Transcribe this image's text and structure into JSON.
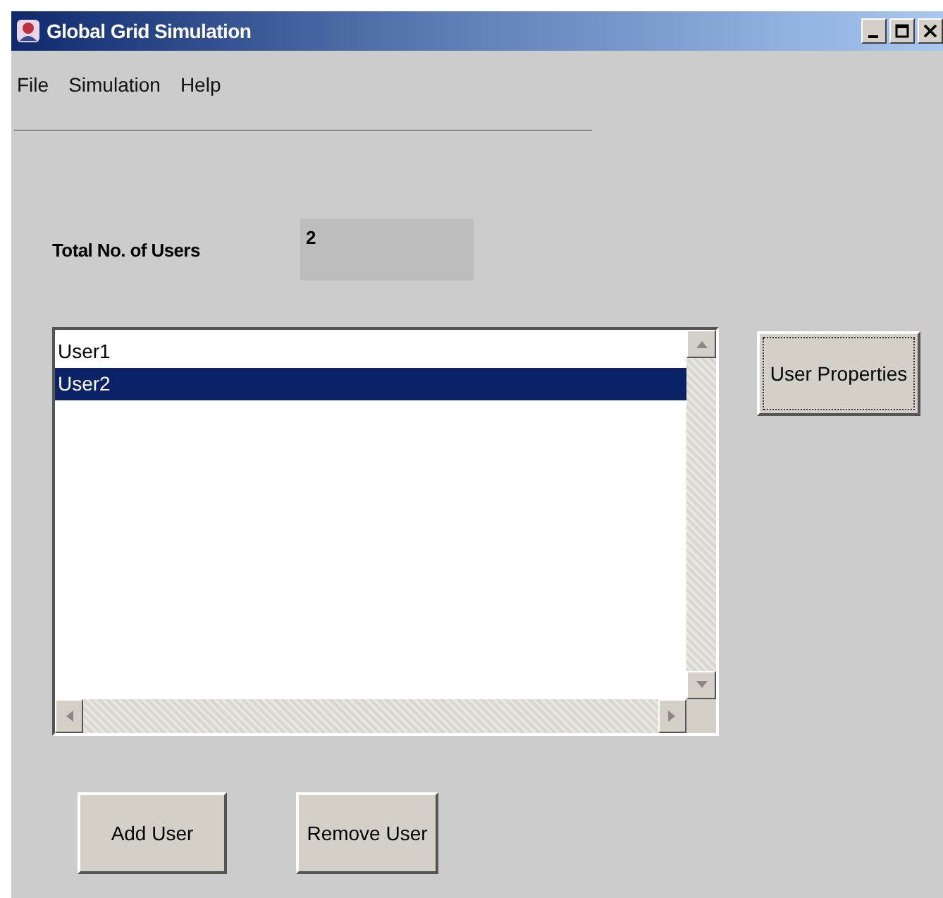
{
  "window": {
    "title": "Global Grid Simulation"
  },
  "menu": [
    "File",
    "Simulation",
    "Help"
  ],
  "total_users": {
    "label": "Total No. of Users",
    "value": "2"
  },
  "users": [
    {
      "name": "User1",
      "selected": false
    },
    {
      "name": "User2",
      "selected": true
    }
  ],
  "buttons": {
    "properties": "User Properties",
    "add": "Add User",
    "remove": "Remove User"
  }
}
